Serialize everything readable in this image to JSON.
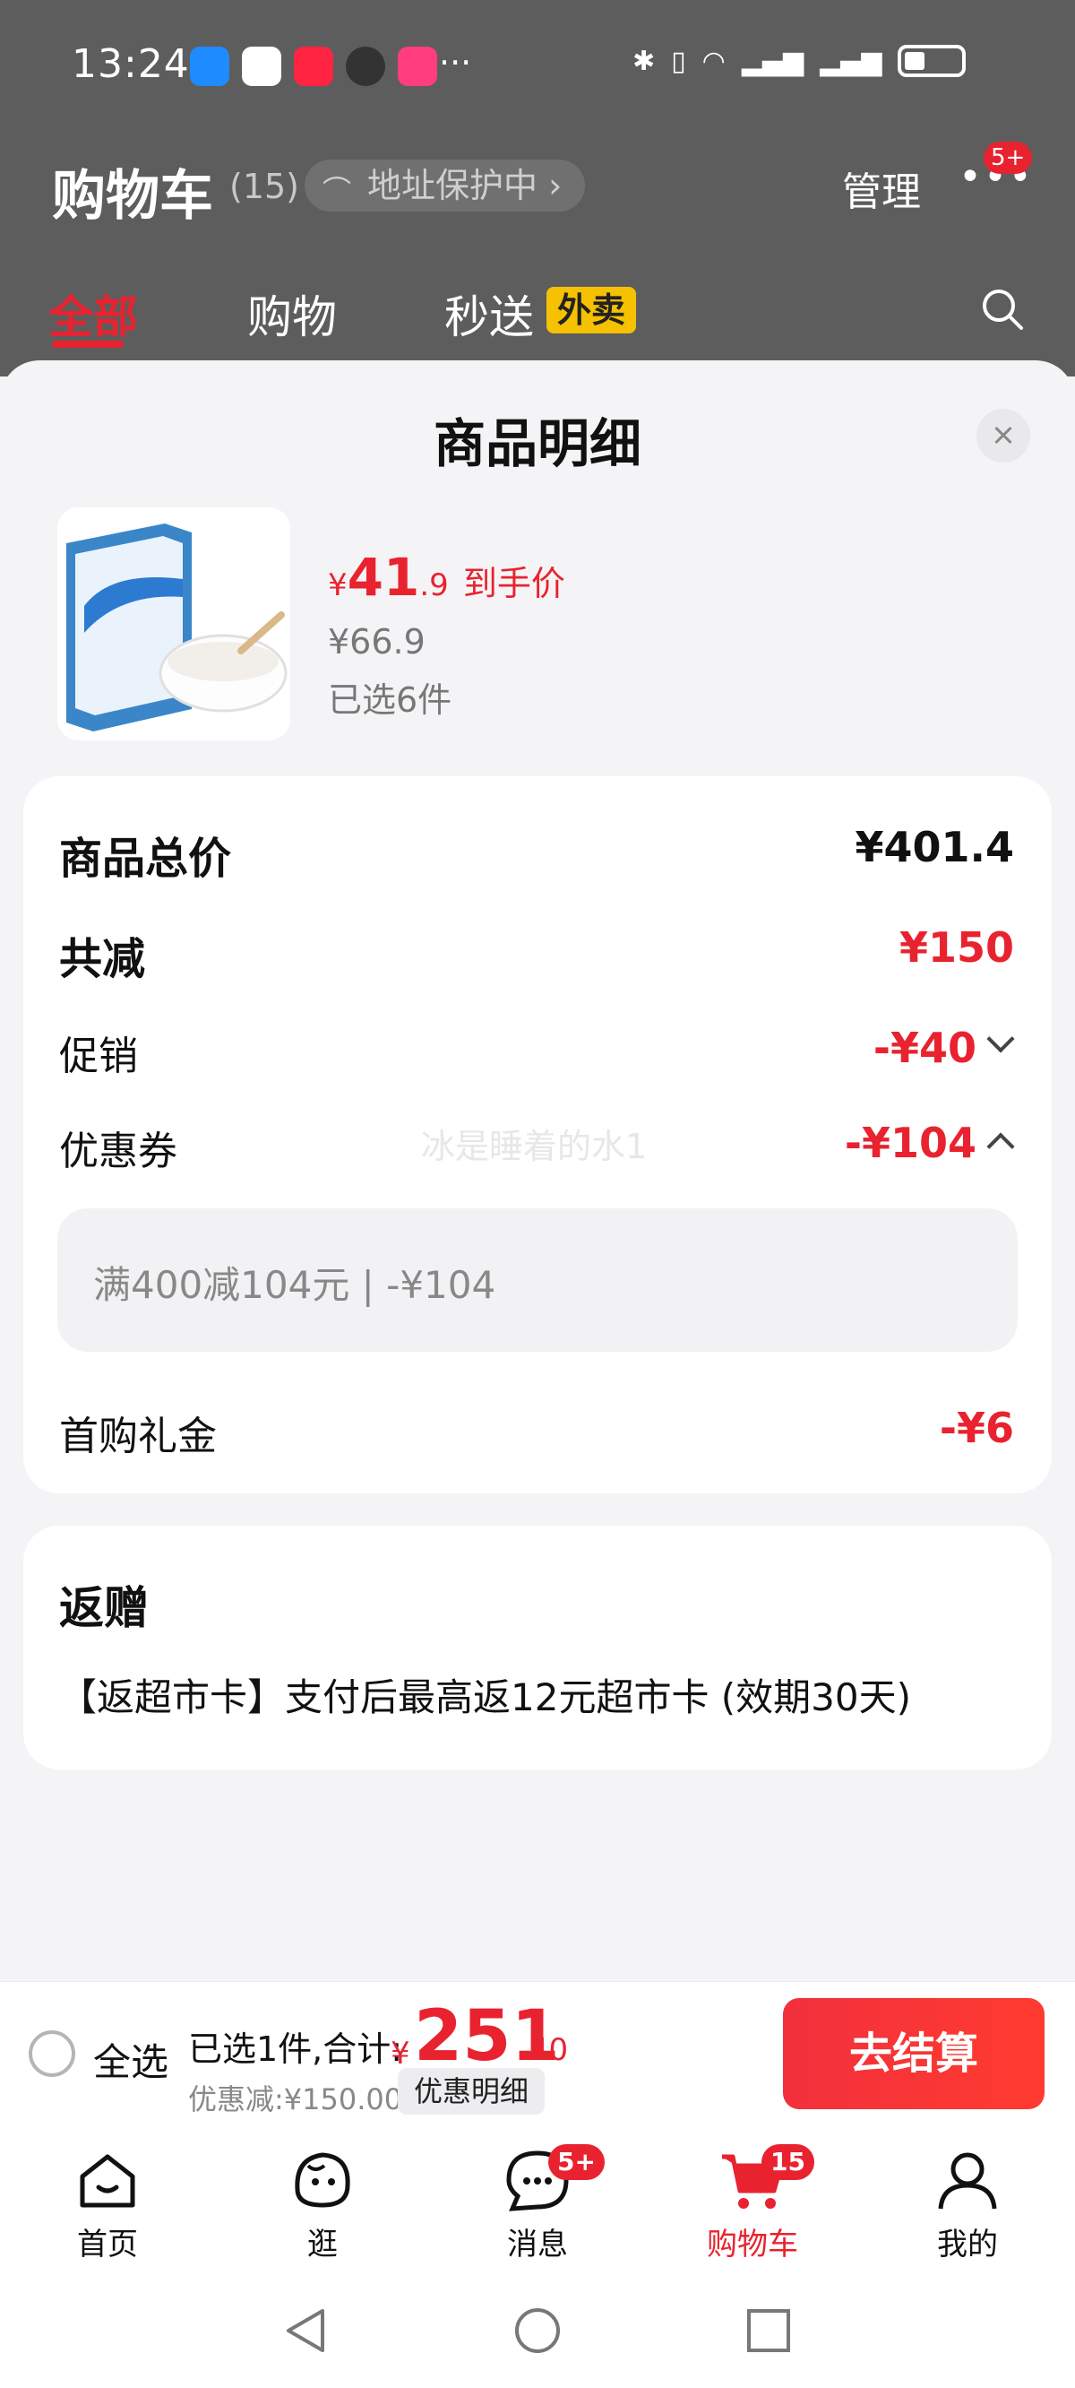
{
  "status_bar": {
    "time": "13:24",
    "more": "···"
  },
  "cart_header": {
    "title": "购物车",
    "count": "(15)",
    "address_pill": "地址保护中",
    "manage": "管理",
    "more_badge": "5+"
  },
  "cart_tabs": {
    "all": "全部",
    "shopping": "购物",
    "flash": "秒送",
    "waimai_tag": "外卖"
  },
  "sheet": {
    "title": "商品明细",
    "product": {
      "price_symbol": "¥",
      "price_int": "41",
      "price_dec": ".9",
      "price_tag": "到手价",
      "original_price": "¥66.9",
      "selected": "已选6件"
    },
    "breakdown": {
      "total_label": "商品总价",
      "total_value": "¥401.4",
      "reduce_label": "共减",
      "reduce_value": "¥150",
      "promo_label": "促销",
      "promo_value": "-¥40",
      "coupon_label": "优惠券",
      "coupon_value": "-¥104",
      "coupon_detail": "满400减104元 | -¥104",
      "first_label": "首购礼金",
      "first_value": "-¥6",
      "watermark": "冰是睡着的水1"
    },
    "gift": {
      "title": "返赠",
      "desc": "【返超市卡】支付后最高返12元超市卡 (效期30天)"
    }
  },
  "checkout": {
    "select_all": "全选",
    "summary": "已选1件,合计:",
    "total_symbol": "¥",
    "total_int": "251",
    "total_dec": ".40",
    "saved": "优惠减:¥150.00",
    "detail_button": "优惠明细",
    "pay_button": "去结算"
  },
  "tabbar": {
    "home": "首页",
    "browse": "逛",
    "messages": "消息",
    "messages_badge": "5+",
    "cart": "购物车",
    "cart_badge": "15",
    "mine": "我的"
  },
  "colors": {
    "accent": "#e8232f",
    "waimai": "#f5c100"
  }
}
